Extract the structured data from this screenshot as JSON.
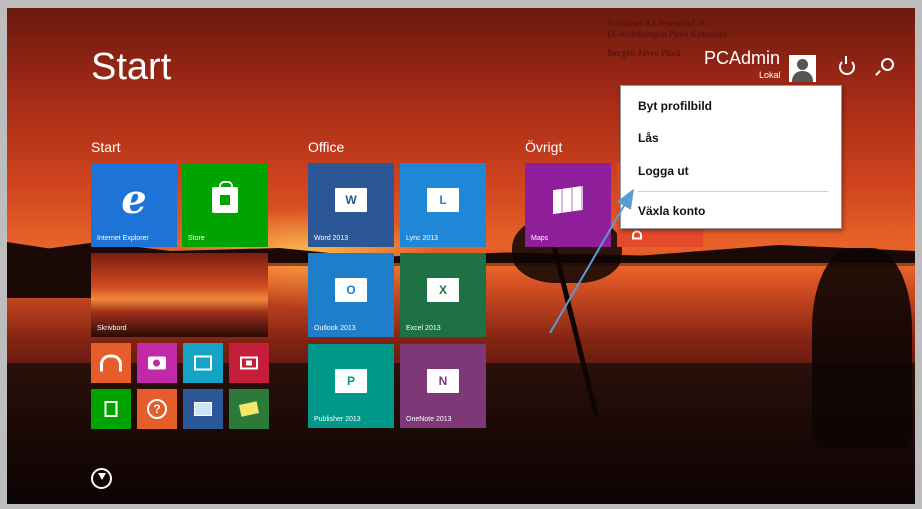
{
  "start": {
    "title": "Start"
  },
  "groups": {
    "start": "Start",
    "office": "Office",
    "ovrigt": "Övrigt"
  },
  "tiles": {
    "ie": "Internet Explorer",
    "store": "Store",
    "desktop": "Skrivbord",
    "word": "Word 2013",
    "lync": "Lync 2013",
    "outlook": "Outlook 2013",
    "excel": "Excel 2013",
    "publisher": "Publisher 2013",
    "onenote": "OneNote 2013",
    "maps": "Maps"
  },
  "tile_icons": {
    "word": "W",
    "lync": "L",
    "outlook": "O",
    "excel": "X",
    "publisher": "P",
    "onenote": "N"
  },
  "user": {
    "name": "PCAdmin",
    "sub": "Lokal"
  },
  "menu": {
    "items": [
      "Byt profilbild",
      "Lås",
      "Logga ut",
      "Växla konto"
    ]
  },
  "watermark": {
    "line1": "Windows 8.1 levererad av",
    "line2": "IT-Avdelningen Piteå Kommun",
    "line3": "Bergön Jävre Piteå"
  },
  "colors": {
    "ie": "#1e73d6",
    "store": "#00a300",
    "word": "#2b5797",
    "lync": "#1f87d6",
    "outlook": "#1f7ec9",
    "excel": "#1e7145",
    "publisher": "#009888",
    "onenote": "#7e3878",
    "maps": "#8e1e9a",
    "menu_bg": "#ffffff",
    "arrow": "#5b9bd5"
  }
}
